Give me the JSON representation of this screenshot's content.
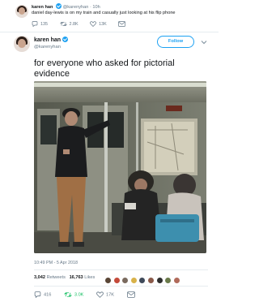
{
  "quoted_tweet": {
    "author_name": "karen han",
    "handle": "@karenyhan",
    "time": "10h",
    "text": "daniel day-lewis is on my train and casually just looking at his flip phone",
    "replies": "135",
    "retweets": "2.8K",
    "likes": "13K"
  },
  "tweet": {
    "author_name": "karen han",
    "handle": "@karenyhan",
    "follow_label": "Follow",
    "text": "for everyone who asked for pictorial evidence",
    "timestamp": "10:49 PM - 5 Apr 2018",
    "retweets_count": "3,042",
    "retweets_label": "Retweets",
    "likes_count": "16,763",
    "likes_label": "Likes",
    "replies": "416",
    "retweets": "3.0K",
    "likes": "17K"
  },
  "colors": {
    "brand_blue": "#1da1f2",
    "retweet_green": "#17bf63",
    "muted_text": "#657786"
  },
  "icons": [
    "reply-icon",
    "retweet-icon",
    "like-icon",
    "dm-icon",
    "verified-badge-icon",
    "chevron-down-icon"
  ]
}
